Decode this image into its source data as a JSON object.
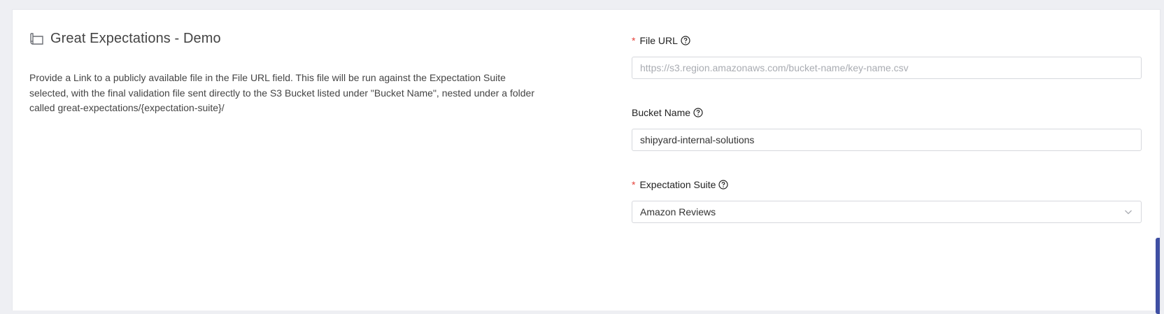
{
  "header": {
    "title": "Great Expectations - Demo",
    "icon": "scroll-icon"
  },
  "description": "Provide a Link to a publicly available file in the File URL field. This file will be run against the Expectation Suite selected, with the final validation file sent directly to the S3 Bucket listed under \"Bucket Name\", nested under a folder called great-expectations/{expectation-suite}/",
  "form": {
    "file_url": {
      "label": "File URL",
      "required_mark": "*",
      "value": "",
      "placeholder": "https://s3.region.amazonaws.com/bucket-name/key-name.csv"
    },
    "bucket_name": {
      "label": "Bucket Name",
      "value": "shipyard-internal-solutions",
      "placeholder": ""
    },
    "expectation_suite": {
      "label": "Expectation Suite",
      "required_mark": "*",
      "selected": "Amazon Reviews"
    }
  },
  "colors": {
    "required": "#e5413a",
    "scrollbar": "#3f4fa3",
    "background": "#eeeff3"
  }
}
